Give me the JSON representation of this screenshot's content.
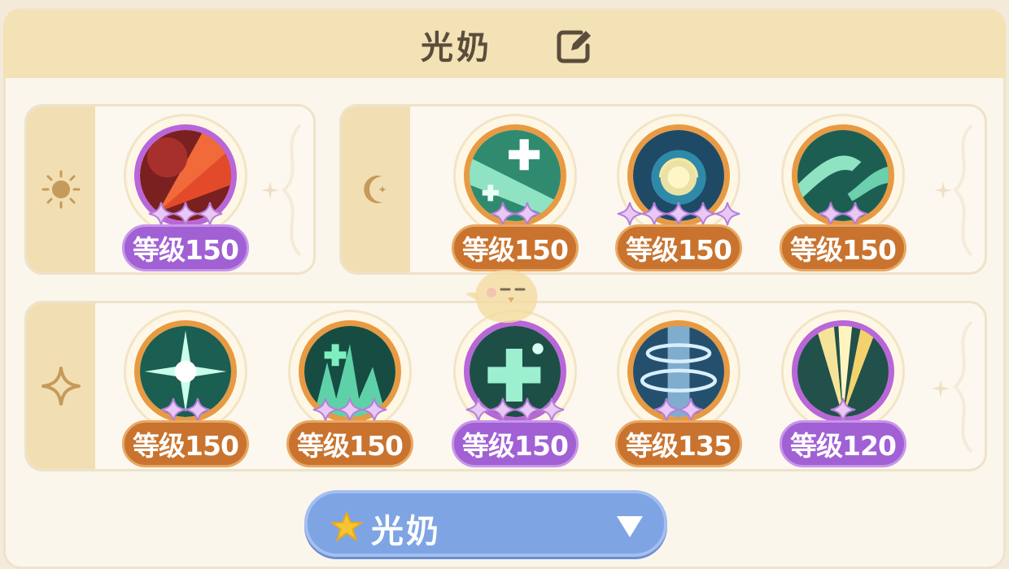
{
  "header": {
    "title": "光奶"
  },
  "rows": [
    {
      "group": "sun",
      "skills": [
        {
          "level": "等级150",
          "stars": 3,
          "frame": "purple",
          "art": "red-fan"
        }
      ]
    },
    {
      "group": "moon",
      "skills": [
        {
          "level": "等级150",
          "stars": 2,
          "frame": "orange",
          "art": "green-heal"
        },
        {
          "level": "等级150",
          "stars": 5,
          "frame": "orange",
          "art": "blue-swirl"
        },
        {
          "level": "等级150",
          "stars": 2,
          "frame": "orange",
          "art": "green-hands"
        }
      ]
    },
    {
      "group": "star",
      "skills": [
        {
          "level": "等级150",
          "stars": 2,
          "frame": "orange",
          "art": "green-burst"
        },
        {
          "level": "等级150",
          "stars": 3,
          "frame": "orange",
          "art": "green-flames"
        },
        {
          "level": "等级150",
          "stars": 4,
          "frame": "purple",
          "art": "green-cross"
        },
        {
          "level": "等级135",
          "stars": 2,
          "frame": "orange",
          "art": "blue-rings"
        },
        {
          "level": "等级120",
          "stars": 1,
          "frame": "purple",
          "art": "gold-rays"
        }
      ]
    }
  ],
  "selector": {
    "label": "光奶",
    "icon": "star-icon",
    "dropdown_icon": "triangle-down-icon"
  },
  "colors": {
    "orange_badge": "#c9732e",
    "purple_badge": "#a160d4",
    "selector": "#7ea4e3",
    "header": "#f3e2b6"
  }
}
